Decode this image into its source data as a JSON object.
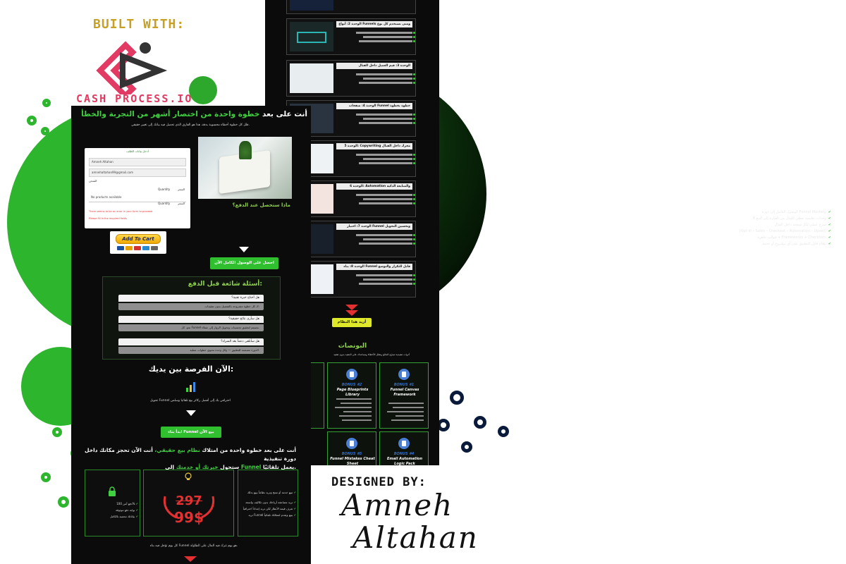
{
  "branding": {
    "built_with": "BUILT WITH:",
    "brand_name": "CASH PROCESS.IO",
    "designed_by": "DESIGNED BY:",
    "designer_first": "Amneh",
    "designer_last": "Altahan"
  },
  "left_panel": {
    "headline_prefix": "أنت على بعد",
    "headline_accent": "خطوة واحدة من اختصار أشهر من التجربة والخطأ",
    "subheadline": "قلل كل خطوة أخطاء محسوبة بدقة، هذا هو الفارق الذي تحصل فيه بيانك إلى تغيير حقيقي.",
    "form": {
      "title": "أدخل بيانات الطلب",
      "name_value": "Amneh Altahan",
      "email_value": "amnehaltahan99@gmail.com",
      "shipping_label": "الشحن",
      "no_products": "No products available",
      "quantity_label": "Quantity",
      "price_label": "السعر",
      "error_text": "There seems to be an error in your form to proceed",
      "error_text_2": "Please fill in the required fields"
    },
    "cart_button": "Add To Cart",
    "what_you_get_title": "ماذا ستحصل عند الدفع؟",
    "what_you_get": [
      "الوصول الكامل إلى دورة Funnel Mastery",
      "8 وحدات تعليمية تغطي القنال من الفكرة إلى البيع",
      "شرح عملي لكل صفحة داخل القنال",
      "(Opt-in – Sales – Checkout – Automation – Upsell)",
      "قوالب جاهزة + Frameworks + Checklists",
      "نظام قابل للتطبيق على أي مشروع أو خدمة"
    ],
    "access_button": "احصل على الوصول الكامل الآن",
    "faq_title": "أسئلة شائعة قبل الدفع:",
    "faq": [
      {
        "q": "هل أحتاج خبرة تقنية؟",
        "a": "لا، كل خطوة مشروحة بالتفصيل بدون تعقيدات."
      },
      {
        "q": "هل سأرى نتائج حقيقية؟",
        "a": "نعم، كل Funnel مصمم لتحقيق تحسينات وتحويل الزوار إلى عملاء."
      },
      {
        "q": "هل سأتلقى دعماً بعد الشراء؟",
        "a": "الدورة مصممة للتطبيق — وكل وحدة تحتوي خطوات عملية."
      }
    ],
    "opportunity_title": "الآن الفرصة بين يديك:",
    "opportunity_sub": "تحويل Funnel احترافي بك إلى أفضل ركائز بيع تلقائيا وسلس",
    "start_button": "ابدأ بناء Funnel بيع الآن",
    "final_line_1_prefix": "أنت على بعد خطوة واحدة من امتلاك",
    "final_line_1_accent": "نظام بيع حقيقي،",
    "final_line_1_suffix": "أنت الآن تحجز مكانك داخل دورة تنفيذية",
    "final_line_2_prefix": "ستحول",
    "final_line_2_accent": "خبرتك أو خدمتك",
    "final_line_2_mid": "إلى",
    "final_line_2_accent2": "Funnel",
    "final_line_2_suffix": "يعمل تلقائيًا.",
    "benefits_left": [
      "دفع آمن 100%",
      "بوابة دفع موثوقة",
      "بياناتك محمية بالكامل"
    ],
    "price_old": "297",
    "price_new": "99$",
    "benefits_right": [
      "تبيع خدمة أو منتج وتريد نظاماً يبيع بدلك",
      "تريد مضاعفة أرباحك بدون تكاليف واسعة",
      "تعرف قيمة الأنظار لكن تريد إعداداً احترافياً",
      "تريد Funnel يبيع ويقدم لعملائك تلقائياً"
    ],
    "bottom_line": "كل يوم تؤجل فيه بناء Funnel هو يوم تترك فيه المال على الطاولة."
  },
  "right_panel": {
    "modules": [
      {
        "title": "الوحدة 2: أنواع Funnels ومتى تستخدم كل نوع"
      },
      {
        "title": "الوحدة 3: قيم العميل داخل القنال"
      },
      {
        "title": "الوحدة 4: صفحات Funnel خطوة بخطوة"
      },
      {
        "title": "الوحدة 5: Copywriting محرك داخل القنال"
      },
      {
        "title": "الوحدة 6: Automation والمتابعة الذكية"
      },
      {
        "title": "الوحدة 7: اختبار Funnel وتحسين التحويل"
      },
      {
        "title": "الوحدة 8: بناء Funnel قابل للتكرار والتوسع"
      }
    ],
    "want_button": "أريد هذا النظام",
    "bonuses_title": "البونصات",
    "bonuses_sub": "أدوات تنفيذية تسرّع النتائج وتقلل الأخطاء وتساعدك على التنفيذ بدون تعقيد",
    "bonuses": [
      {
        "tag": "BONUS #1",
        "name": "Funnel Canvas Framework"
      },
      {
        "tag": "BONUS #2",
        "name": "Page Blueprints Library"
      },
      {
        "tag": "BONUS #4",
        "name": "Email Automation Logic Pack"
      },
      {
        "tag": "BONUS #5",
        "name": "Funnel Mistakes Cheat Sheet"
      }
    ]
  },
  "colors": {
    "accent_green": "#3fd13f",
    "panel_bg": "#0b0b0b",
    "price_red": "#e43030",
    "brand_pink": "#e33a63"
  }
}
